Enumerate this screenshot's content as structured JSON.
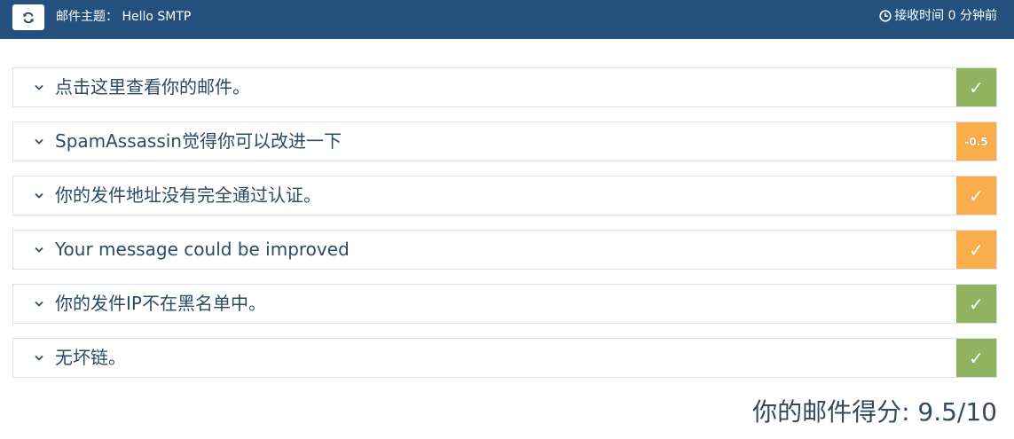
{
  "header": {
    "subject_label": "邮件主题：",
    "subject_value": "Hello SMTP",
    "received_text": "接收时间 0 分钟前",
    "refresh_icon": "refresh-icon",
    "clock_icon": "clock-icon"
  },
  "checks": [
    {
      "label": "点击这里查看你的邮件。",
      "status": "ok",
      "status_text": "✓",
      "color": "#8fb35f"
    },
    {
      "label": "SpamAssassin觉得你可以改进一下",
      "status": "score",
      "status_text": "-0.5",
      "color": "#f9ad4c"
    },
    {
      "label": "你的发件地址没有完全通过认证。",
      "status": "warn",
      "status_text": "✓",
      "color": "#f9ad4c"
    },
    {
      "label": "Your message could be improved",
      "status": "warn",
      "status_text": "✓",
      "color": "#f9ad4c"
    },
    {
      "label": "你的发件IP不在黑名单中。",
      "status": "ok",
      "status_text": "✓",
      "color": "#8fb35f"
    },
    {
      "label": "无坏链。",
      "status": "ok",
      "status_text": "✓",
      "color": "#8fb35f"
    }
  ],
  "score": {
    "text": "你的邮件得分: 9.5/10"
  },
  "colors": {
    "header_bg": "#24507d",
    "ok": "#8fb35f",
    "warn": "#f9ad4c"
  }
}
